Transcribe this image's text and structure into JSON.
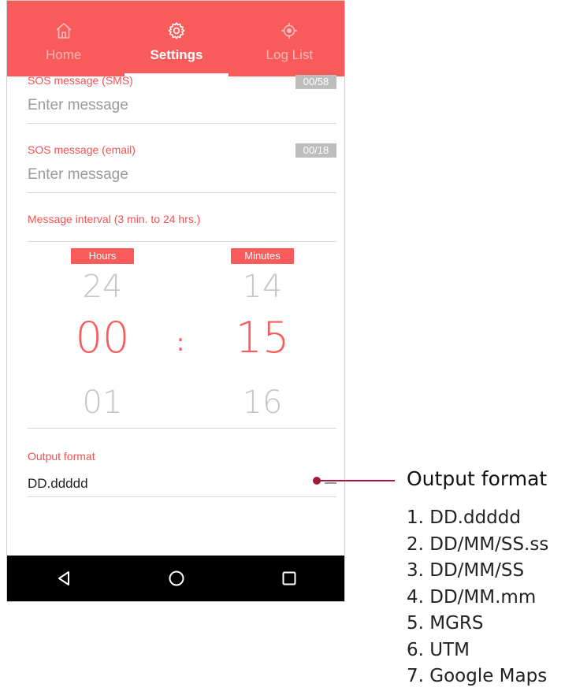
{
  "nav": {
    "tabs": [
      {
        "label": "Home",
        "icon": "home-icon"
      },
      {
        "label": "Settings",
        "icon": "gear-icon"
      },
      {
        "label": "Log List",
        "icon": "location-icon"
      }
    ],
    "active_tab": "Settings"
  },
  "form": {
    "sos_sms": {
      "label": "SOS message (SMS)",
      "counter": "00/58",
      "placeholder": "Enter message",
      "value": ""
    },
    "sos_email": {
      "label": "SOS message (email)",
      "counter": "00/18",
      "placeholder": "Enter message",
      "value": ""
    },
    "interval": {
      "label": "Message interval (3 min. to 24 hrs.)",
      "hours": {
        "header": "Hours",
        "prev": "24",
        "selected": "00",
        "next": "01"
      },
      "separator": ":",
      "minutes": {
        "header": "Minutes",
        "prev": "14",
        "selected": "15",
        "next": "16"
      }
    },
    "output_format": {
      "label": "Output format",
      "value": "DD.ddddd"
    }
  },
  "system_nav": {
    "icons": [
      "back-icon",
      "home-circle-icon",
      "recents-icon"
    ]
  },
  "callout": {
    "title": "Output format",
    "items": [
      "1. DD.ddddd",
      "2. DD/MM/SS.ss",
      "3. DD/MM/SS",
      "4. DD/MM.mm",
      "5. MGRS",
      "6. UTM",
      "7. Google Maps"
    ]
  },
  "colors": {
    "accent": "#f95b5b",
    "callout_line": "#a2193a",
    "system_bar": "#000000"
  }
}
